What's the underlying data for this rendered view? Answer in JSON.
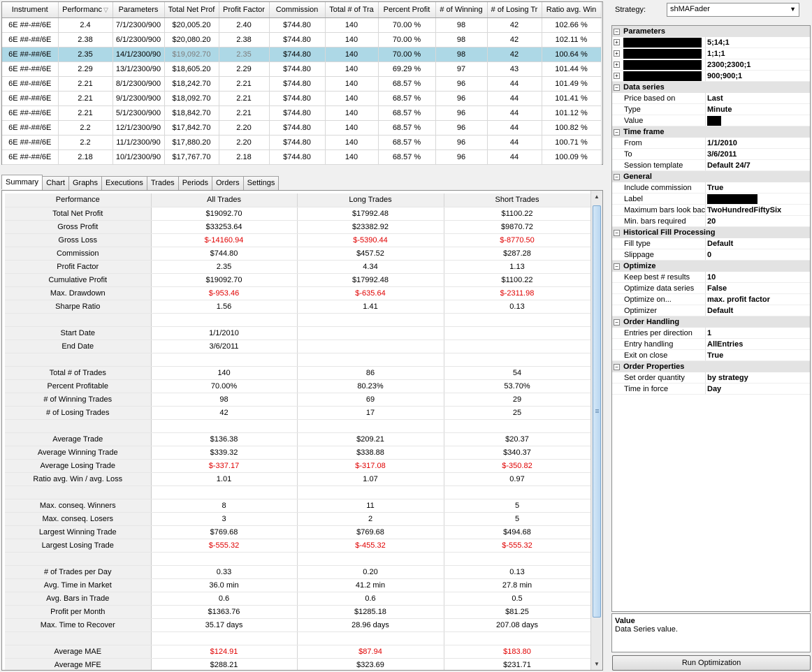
{
  "results": {
    "columns": [
      "Instrument",
      "Performanc",
      "Parameters",
      "Total Net Prof",
      "Profit Factor",
      "Commission",
      "Total # of Tra",
      "Percent Profit",
      "# of Winning",
      "# of Losing Tr",
      "Ratio avg. Win"
    ],
    "rows": [
      [
        "6E ##-##/6E",
        "2.4",
        "7/1/2300/900",
        "$20,005.20",
        "2.40",
        "$744.80",
        "140",
        "70.00 %",
        "98",
        "42",
        "102.66 %"
      ],
      [
        "6E ##-##/6E",
        "2.38",
        "6/1/2300/900",
        "$20,080.20",
        "2.38",
        "$744.80",
        "140",
        "70.00 %",
        "98",
        "42",
        "102.11 %"
      ],
      [
        "6E ##-##/6E",
        "2.35",
        "14/1/2300/90",
        "$19,092.70",
        "2.35",
        "$744.80",
        "140",
        "70.00 %",
        "98",
        "42",
        "100.64 %"
      ],
      [
        "6E ##-##/6E",
        "2.29",
        "13/1/2300/90",
        "$18,605.20",
        "2.29",
        "$744.80",
        "140",
        "69.29 %",
        "97",
        "43",
        "101.44 %"
      ],
      [
        "6E ##-##/6E",
        "2.21",
        "8/1/2300/900",
        "$18,242.70",
        "2.21",
        "$744.80",
        "140",
        "68.57 %",
        "96",
        "44",
        "101.49 %"
      ],
      [
        "6E ##-##/6E",
        "2.21",
        "9/1/2300/900",
        "$18,092.70",
        "2.21",
        "$744.80",
        "140",
        "68.57 %",
        "96",
        "44",
        "101.41 %"
      ],
      [
        "6E ##-##/6E",
        "2.21",
        "5/1/2300/900",
        "$18,842.70",
        "2.21",
        "$744.80",
        "140",
        "68.57 %",
        "96",
        "44",
        "101.12 %"
      ],
      [
        "6E ##-##/6E",
        "2.2",
        "12/1/2300/90",
        "$17,842.70",
        "2.20",
        "$744.80",
        "140",
        "68.57 %",
        "96",
        "44",
        "100.82 %"
      ],
      [
        "6E ##-##/6E",
        "2.2",
        "11/1/2300/90",
        "$17,880.20",
        "2.20",
        "$744.80",
        "140",
        "68.57 %",
        "96",
        "44",
        "100.71 %"
      ],
      [
        "6E ##-##/6E",
        "2.18",
        "10/1/2300/90",
        "$17,767.70",
        "2.18",
        "$744.80",
        "140",
        "68.57 %",
        "96",
        "44",
        "100.09 %"
      ]
    ],
    "selected_row": 2
  },
  "tabs": [
    {
      "label": "Summary",
      "active": true
    },
    {
      "label": "Chart",
      "active": false
    },
    {
      "label": "Graphs",
      "active": false
    },
    {
      "label": "Executions",
      "active": false
    },
    {
      "label": "Trades",
      "active": false
    },
    {
      "label": "Periods",
      "active": false
    },
    {
      "label": "Orders",
      "active": false
    },
    {
      "label": "Settings",
      "active": false
    }
  ],
  "summary": {
    "header": [
      "Performance",
      "All Trades",
      "Long Trades",
      "Short Trades"
    ],
    "rows": [
      {
        "label": "Total Net Profit",
        "values": [
          "$19092.70",
          "$17992.48",
          "$1100.22"
        ]
      },
      {
        "label": "Gross Profit",
        "values": [
          "$33253.64",
          "$23382.92",
          "$9870.72"
        ]
      },
      {
        "label": "Gross Loss",
        "values": [
          "$-14160.94",
          "$-5390.44",
          "$-8770.50"
        ],
        "negative": true
      },
      {
        "label": "Commission",
        "values": [
          "$744.80",
          "$457.52",
          "$287.28"
        ]
      },
      {
        "label": "Profit Factor",
        "values": [
          "2.35",
          "4.34",
          "1.13"
        ]
      },
      {
        "label": "Cumulative Profit",
        "values": [
          "$19092.70",
          "$17992.48",
          "$1100.22"
        ]
      },
      {
        "label": "Max. Drawdown",
        "values": [
          "$-953.46",
          "$-635.64",
          "$-2311.98"
        ],
        "negative": true
      },
      {
        "label": "Sharpe Ratio",
        "values": [
          "1.56",
          "1.41",
          "0.13"
        ]
      },
      {
        "label": "",
        "values": [
          "",
          "",
          ""
        ]
      },
      {
        "label": "Start Date",
        "values": [
          "1/1/2010",
          "",
          ""
        ]
      },
      {
        "label": "End Date",
        "values": [
          "3/6/2011",
          "",
          ""
        ]
      },
      {
        "label": "",
        "values": [
          "",
          "",
          ""
        ]
      },
      {
        "label": "Total # of Trades",
        "values": [
          "140",
          "86",
          "54"
        ]
      },
      {
        "label": "Percent Profitable",
        "values": [
          "70.00%",
          "80.23%",
          "53.70%"
        ]
      },
      {
        "label": "# of Winning Trades",
        "values": [
          "98",
          "69",
          "29"
        ]
      },
      {
        "label": "# of Losing Trades",
        "values": [
          "42",
          "17",
          "25"
        ]
      },
      {
        "label": "",
        "values": [
          "",
          "",
          ""
        ]
      },
      {
        "label": "Average Trade",
        "values": [
          "$136.38",
          "$209.21",
          "$20.37"
        ]
      },
      {
        "label": "Average Winning Trade",
        "values": [
          "$339.32",
          "$338.88",
          "$340.37"
        ]
      },
      {
        "label": "Average Losing Trade",
        "values": [
          "$-337.17",
          "$-317.08",
          "$-350.82"
        ],
        "negative": true
      },
      {
        "label": "Ratio avg. Win / avg. Loss",
        "values": [
          "1.01",
          "1.07",
          "0.97"
        ]
      },
      {
        "label": "",
        "values": [
          "",
          "",
          ""
        ]
      },
      {
        "label": "Max. conseq. Winners",
        "values": [
          "8",
          "11",
          "5"
        ]
      },
      {
        "label": "Max. conseq. Losers",
        "values": [
          "3",
          "2",
          "5"
        ]
      },
      {
        "label": "Largest Winning Trade",
        "values": [
          "$769.68",
          "$769.68",
          "$494.68"
        ]
      },
      {
        "label": "Largest Losing Trade",
        "values": [
          "$-555.32",
          "$-455.32",
          "$-555.32"
        ],
        "negative": true
      },
      {
        "label": "",
        "values": [
          "",
          "",
          ""
        ]
      },
      {
        "label": "# of Trades per Day",
        "values": [
          "0.33",
          "0.20",
          "0.13"
        ]
      },
      {
        "label": "Avg. Time in Market",
        "values": [
          "36.0 min",
          "41.2 min",
          "27.8 min"
        ]
      },
      {
        "label": "Avg. Bars in Trade",
        "values": [
          "0.6",
          "0.6",
          "0.5"
        ]
      },
      {
        "label": "Profit per Month",
        "values": [
          "$1363.76",
          "$1285.18",
          "$81.25"
        ]
      },
      {
        "label": "Max. Time to Recover",
        "values": [
          "35.17 days",
          "28.96 days",
          "207.08 days"
        ]
      },
      {
        "label": "",
        "values": [
          "",
          "",
          ""
        ]
      },
      {
        "label": "Average MAE",
        "values": [
          "$124.91",
          "$87.94",
          "$183.80"
        ],
        "negative": true
      },
      {
        "label": "Average MFE",
        "values": [
          "$288.21",
          "$323.69",
          "$231.71"
        ]
      }
    ]
  },
  "strategy": {
    "label": "Strategy:",
    "value": "shMAFader"
  },
  "properties": [
    {
      "category": "Parameters",
      "items": [
        {
          "name": "",
          "value": "5;14;1",
          "expandable": true,
          "redacted_name": true
        },
        {
          "name": "",
          "value": "1;1;1",
          "expandable": true,
          "redacted_name": true
        },
        {
          "name": "",
          "value": "2300;2300;1",
          "expandable": true,
          "redacted_name": true
        },
        {
          "name": "",
          "value": "900;900;1",
          "expandable": true,
          "redacted_name": true
        }
      ]
    },
    {
      "category": "Data series",
      "items": [
        {
          "name": "Price based on",
          "value": "Last"
        },
        {
          "name": "Type",
          "value": "Minute"
        },
        {
          "name": "Value",
          "value": "",
          "redacted_value": true
        }
      ]
    },
    {
      "category": "Time frame",
      "items": [
        {
          "name": "From",
          "value": "1/1/2010"
        },
        {
          "name": "To",
          "value": "3/6/2011"
        },
        {
          "name": "Session template",
          "value": "Default 24/7"
        }
      ]
    },
    {
      "category": "General",
      "items": [
        {
          "name": "Include commission",
          "value": "True"
        },
        {
          "name": "Label",
          "value": "",
          "redacted_value": true
        },
        {
          "name": "Maximum bars look bac",
          "value": "TwoHundredFiftySix"
        },
        {
          "name": "Min. bars required",
          "value": "20"
        }
      ]
    },
    {
      "category": "Historical Fill Processing",
      "items": [
        {
          "name": "Fill type",
          "value": "Default"
        },
        {
          "name": "Slippage",
          "value": "0"
        }
      ]
    },
    {
      "category": "Optimize",
      "items": [
        {
          "name": "Keep best # results",
          "value": "10"
        },
        {
          "name": "Optimize data series",
          "value": "False"
        },
        {
          "name": "Optimize on...",
          "value": "max. profit factor"
        },
        {
          "name": "Optimizer",
          "value": "Default"
        }
      ]
    },
    {
      "category": "Order Handling",
      "items": [
        {
          "name": "Entries per direction",
          "value": "1"
        },
        {
          "name": "Entry handling",
          "value": "AllEntries"
        },
        {
          "name": "Exit on close",
          "value": "True"
        }
      ]
    },
    {
      "category": "Order Properties",
      "items": [
        {
          "name": "Set order quantity",
          "value": "by strategy"
        },
        {
          "name": "Time in force",
          "value": "Day"
        }
      ]
    }
  ],
  "help": {
    "title": "Value",
    "text": "Data Series value."
  },
  "run_button": "Run Optimization",
  "colors": {
    "selected_row": "#add8e6",
    "negative": "#e00000"
  }
}
